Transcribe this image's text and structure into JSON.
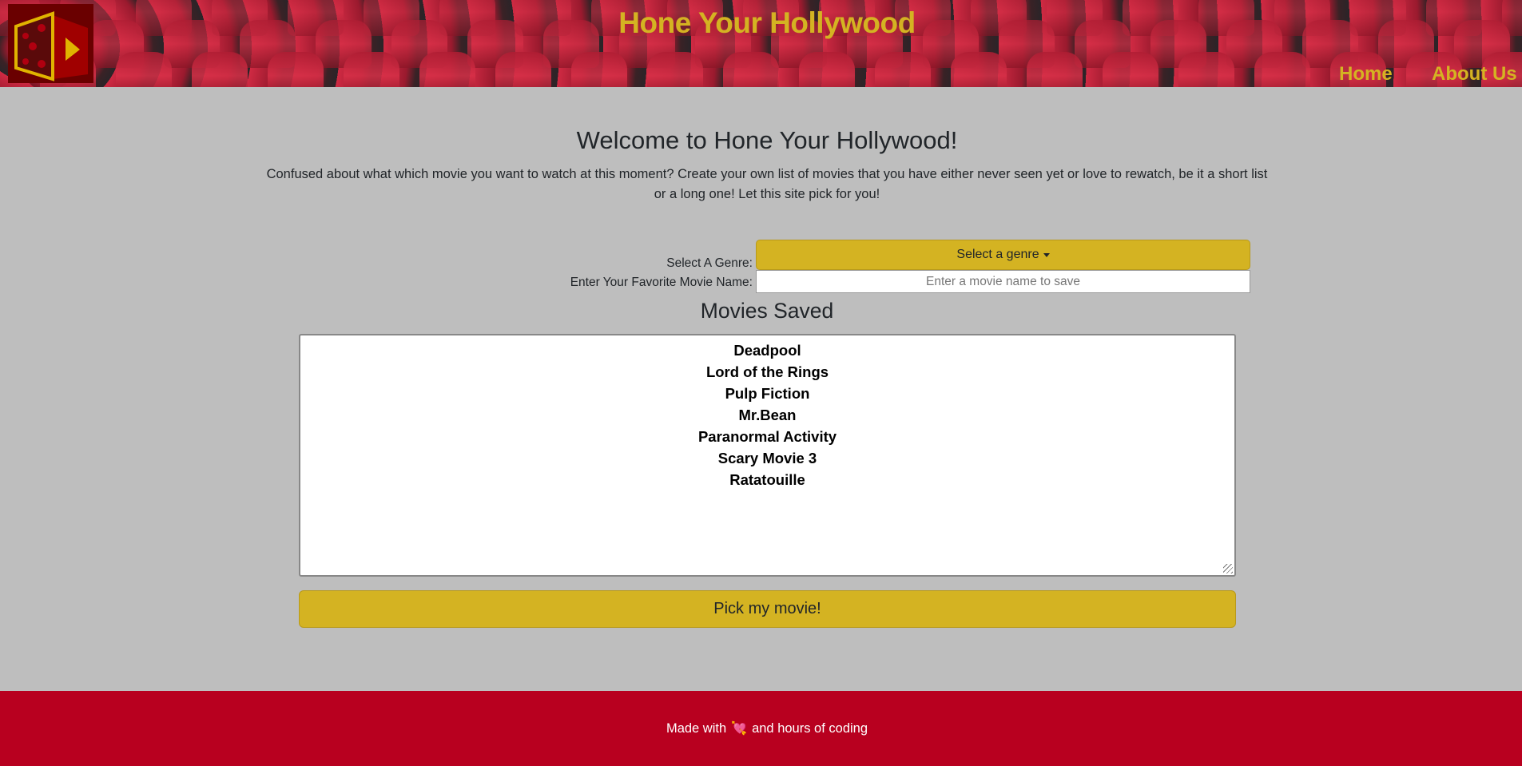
{
  "header": {
    "title": "Hone Your Hollywood",
    "nav": [
      {
        "label": "Home"
      },
      {
        "label": "About Us"
      }
    ],
    "logo": "dice-play-logo"
  },
  "main": {
    "welcome": "Welcome to Hone Your Hollywood!",
    "intro": "Confused about what which movie you want to watch at this moment? Create your own list of movies that you have either never seen yet or love to rewatch, be it a short list or a long one! Let this site pick for you!",
    "genre_label": "Select A Genre:",
    "genre_button": "Select a genre",
    "movie_label": "Enter Your Favorite Movie Name:",
    "movie_placeholder": "Enter a movie name to save",
    "saved_heading": "Movies Saved",
    "movies": [
      "Deadpool",
      "Lord of the Rings",
      "Pulp Fiction",
      "Mr.Bean",
      "Paranormal Activity",
      "Scary Movie 3",
      "Ratatouille"
    ],
    "pick_button": "Pick my movie!"
  },
  "footer": {
    "before": "Made with",
    "emoji": "💘",
    "after": "and hours of coding"
  },
  "colors": {
    "accent": "#d4b322",
    "footer": "#b8001f",
    "background": "#bebebe"
  }
}
